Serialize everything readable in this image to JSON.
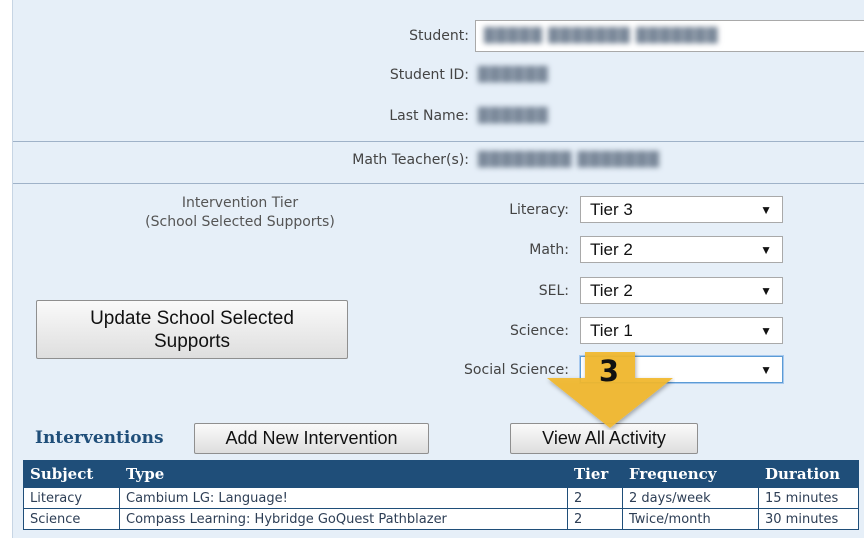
{
  "student": {
    "student_label": "Student:",
    "student_value": "█████ ███████ ███████",
    "id_label": "Student ID:",
    "id_value": "██████",
    "last_name_label": "Last Name:",
    "last_name_value": "██████",
    "math_teacher_label": "Math Teacher(s):",
    "math_teacher_value": "████████ ███████"
  },
  "tiers": {
    "heading_line1": "Intervention Tier",
    "heading_line2": "(School Selected Supports)",
    "rows": [
      {
        "label": "Literacy:",
        "value": "Tier 3"
      },
      {
        "label": "Math:",
        "value": "Tier 2"
      },
      {
        "label": "SEL:",
        "value": "Tier 2"
      },
      {
        "label": "Science:",
        "value": "Tier 1"
      },
      {
        "label": "Social Science:",
        "value": ""
      }
    ],
    "arrow_glyph": "▼"
  },
  "buttons": {
    "update_line1": "Update School Selected",
    "update_line2": "Supports",
    "add_intervention": "Add New Intervention",
    "view_all_activity": "View All Activity"
  },
  "interventions": {
    "title": "Interventions",
    "headers": [
      "Subject",
      "Type",
      "Tier",
      "Frequency",
      "Duration"
    ],
    "rows": [
      [
        "Literacy",
        "Cambium LG: Language!",
        "2",
        "2 days/week",
        "15 minutes"
      ],
      [
        "Science",
        "Compass Learning: Hybridge GoQuest Pathblazer",
        "2",
        "Twice/month",
        "30 minutes"
      ]
    ]
  },
  "callout": {
    "number": "3",
    "color": "#f2b92b"
  }
}
